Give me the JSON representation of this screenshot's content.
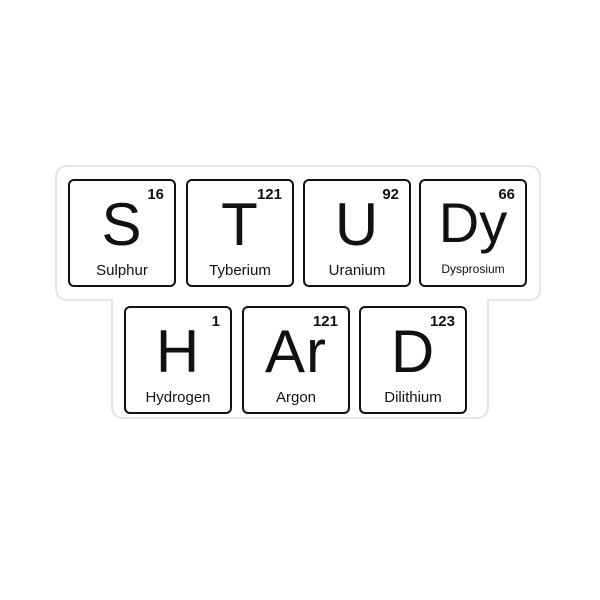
{
  "row1": [
    {
      "number": "16",
      "symbol": "S",
      "name": "Sulphur"
    },
    {
      "number": "121",
      "symbol": "T",
      "name": "Tyberium"
    },
    {
      "number": "92",
      "symbol": "U",
      "name": "Uranium"
    },
    {
      "number": "66",
      "symbol": "Dy",
      "name": "Dysprosium"
    }
  ],
  "row2": [
    {
      "number": "1",
      "symbol": "H",
      "name": "Hydrogen"
    },
    {
      "number": "121",
      "symbol": "Ar",
      "name": "Argon"
    },
    {
      "number": "123",
      "symbol": "D",
      "name": "Dilithium"
    }
  ],
  "colors": {
    "ink": "#111111",
    "background": "#ffffff",
    "sticker_border": "#e6e6e6"
  }
}
